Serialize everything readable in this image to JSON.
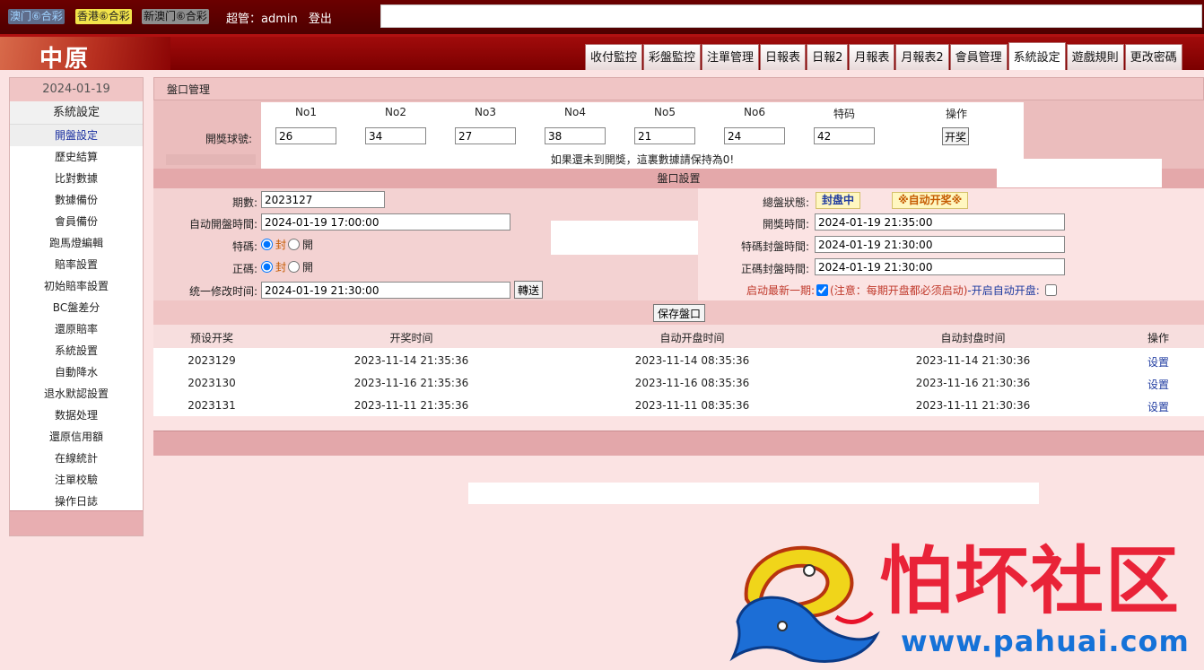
{
  "topbar": {
    "lotteries": [
      "澳门⑥合彩",
      "香港⑥合彩",
      "新澳门⑥合彩"
    ],
    "user_label": "超管：admin",
    "logout_label": "登出"
  },
  "brand": {
    "logo_text": "中原"
  },
  "tabs": [
    "收付監控",
    "彩盤監控",
    "注單管理",
    "日報表",
    "日報2",
    "月報表",
    "月報表2",
    "會員管理",
    "系統設定",
    "遊戲規則",
    "更改密碼"
  ],
  "active_tab": "系統設定",
  "sidebar": {
    "date": "2024-01-19",
    "title": "系統設定",
    "items": [
      "開盤設定",
      "歷史結算",
      "比對數據",
      "數據備份",
      "會員備份",
      "跑馬燈編輯",
      "賠率設置",
      "初始賠率設置",
      "BC盤差分",
      "還原賠率",
      "系統設置",
      "自動降水",
      "退水默認設置",
      "数据处理",
      "還原信用額",
      "在線統計",
      "注單校驗",
      "操作日誌"
    ],
    "active_item": "開盤設定"
  },
  "panel": {
    "title": "盤口管理"
  },
  "draw": {
    "label": "開獎球號:",
    "headers": [
      "No1",
      "No2",
      "No3",
      "No4",
      "No5",
      "No6",
      "特码",
      "操作"
    ],
    "values": [
      "26",
      "34",
      "27",
      "38",
      "21",
      "24",
      "42"
    ],
    "button": "开奖",
    "note": "如果還未到開獎，這裏數據請保持為0!"
  },
  "setup": {
    "bar_title": "盤口設置",
    "period_label": "期數:",
    "period_value": "2023127",
    "auto_open_label": "自动開盤時間:",
    "auto_open_value": "2024-01-19 17:00:00",
    "special_label": "特碼:",
    "normal_label": "正碼:",
    "radio_closed": "封",
    "radio_open": "開",
    "unified_label": "统一修改时间:",
    "unified_value": "2024-01-19 21:30:00",
    "send_button": "轉送",
    "status_label": "總盤狀態:",
    "status_closed": "封盘中",
    "status_auto": "※自动开奖※",
    "draw_time_label": "開獎時間:",
    "draw_time_value": "2024-01-19 21:35:00",
    "special_close_label": "特碼封盤時間:",
    "special_close_value": "2024-01-19 21:30:00",
    "normal_close_label": "正碼封盤時間:",
    "normal_close_value": "2024-01-19 21:30:00",
    "auto_latest_label": "启动最新一期:",
    "auto_note": "(注意：每期开盘都必须启动)",
    "auto_open_draw_label": "-开启自动开盘:",
    "save_button": "保存盤口"
  },
  "schedule": {
    "headers": [
      "预设开奖",
      "开奖时间",
      "自动开盘时间",
      "自动封盘时间",
      "操作"
    ],
    "rows": [
      {
        "period": "2023129",
        "draw_time": "2023-11-14 21:35:36",
        "open_time": "2023-11-14 08:35:36",
        "close_time": "2023-11-14 21:30:36",
        "action": "设置"
      },
      {
        "period": "2023130",
        "draw_time": "2023-11-16 21:35:36",
        "open_time": "2023-11-16 08:35:36",
        "close_time": "2023-11-16 21:30:36",
        "action": "设置"
      },
      {
        "period": "2023131",
        "draw_time": "2023-11-11 21:35:36",
        "open_time": "2023-11-11 08:35:36",
        "close_time": "2023-11-11 21:30:36",
        "action": "设置"
      }
    ]
  },
  "watermark": {
    "title": "怕坏社区",
    "url": "www.pahuai.com"
  },
  "colors": {
    "header_dark": "#5a0000",
    "brand_red": "#a10b0b",
    "panel_pink": "#f0c5c5",
    "link_blue": "#1f3ba0",
    "watermark_red": "#e8132a",
    "watermark_blue": "#1572d8"
  }
}
